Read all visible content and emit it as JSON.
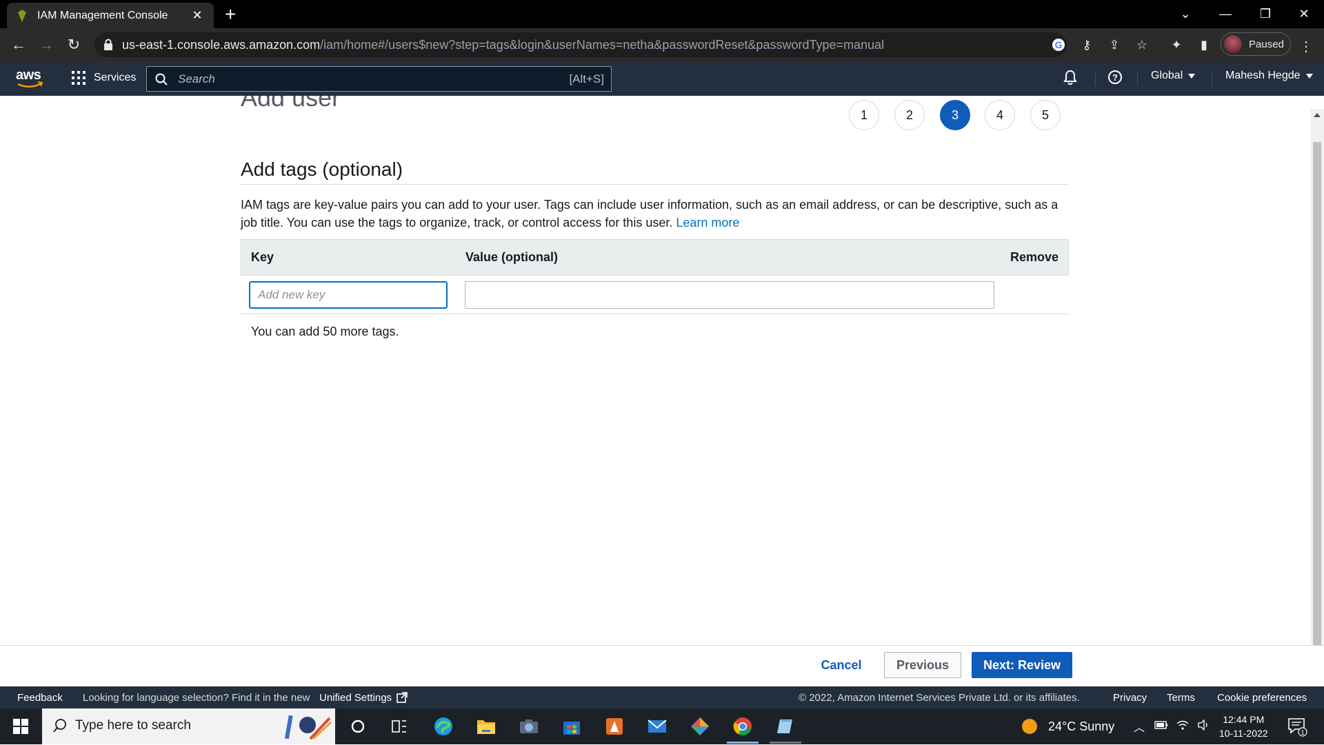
{
  "browser": {
    "tab_title": "IAM Management Console",
    "url_host": "us-east-1.console.aws.amazon.com",
    "url_path": "/iam/home#/users$new?step=tags&login&userNames=netha&passwordReset&passwordType=manual",
    "profile_status": "Paused"
  },
  "aws_nav": {
    "logo": "aws",
    "services": "Services",
    "search_placeholder": "Search",
    "search_shortcut": "[Alt+S]",
    "region": "Global",
    "user": "Mahesh Hegde"
  },
  "page": {
    "heading": "Add user",
    "steps": [
      "1",
      "2",
      "3",
      "4",
      "5"
    ],
    "active_step": 3,
    "section_title": "Add tags (optional)",
    "description": "IAM tags are key-value pairs you can add to your user. Tags can include user information, such as an email address, or can be descriptive, such as a job title. You can use the tags to organize, track, or control access for this user.",
    "learn_more": "Learn more",
    "table": {
      "col_key": "Key",
      "col_value": "Value (optional)",
      "col_remove": "Remove",
      "key_placeholder": "Add new key",
      "key_value": "",
      "value_value": ""
    },
    "remaining_tags": "You can add 50 more tags."
  },
  "actions": {
    "cancel": "Cancel",
    "previous": "Previous",
    "next": "Next: Review"
  },
  "footer": {
    "feedback": "Feedback",
    "lang_prompt": "Looking for language selection? Find it in the new",
    "unified_settings": "Unified Settings",
    "copyright": "© 2022, Amazon Internet Services Private Ltd. or its affiliates.",
    "privacy": "Privacy",
    "terms": "Terms",
    "cookie": "Cookie preferences"
  },
  "taskbar": {
    "search_placeholder": "Type here to search",
    "weather": "24°C  Sunny",
    "time": "12:44 PM",
    "date": "10-11-2022",
    "notification_count": "1"
  },
  "colors": {
    "aws_nav_bg": "#232f3e",
    "primary_blue": "#0f5cba",
    "link_blue": "#0073bb"
  }
}
